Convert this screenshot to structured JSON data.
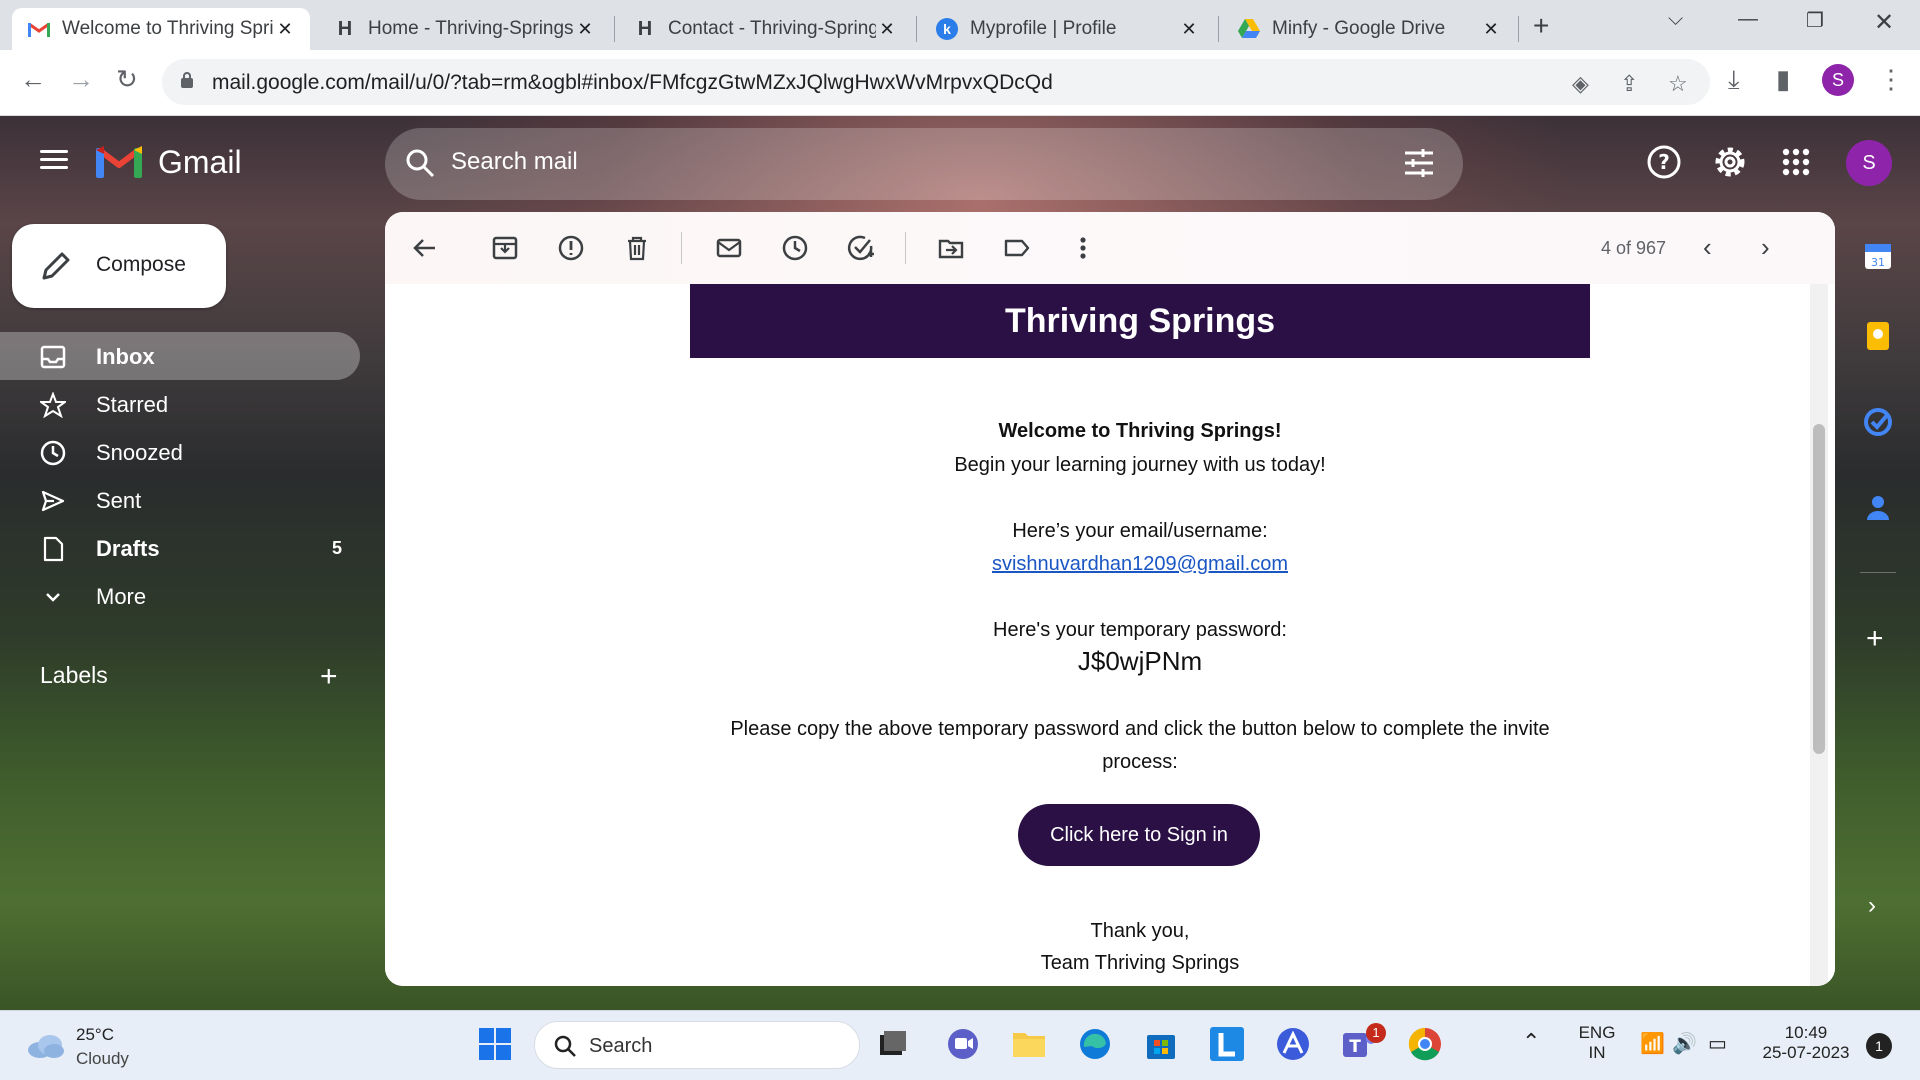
{
  "browser": {
    "tabs": [
      {
        "label": "Welcome to Thriving Spri",
        "active": true,
        "icon": "gmail-icon"
      },
      {
        "label": "Home - Thriving-Springs",
        "active": false,
        "icon": "h-site-icon"
      },
      {
        "label": "Contact - Thriving-Spring",
        "active": false,
        "icon": "h-site-icon"
      },
      {
        "label": "Myprofile | Profile",
        "active": false,
        "icon": "k-site-icon"
      },
      {
        "label": "Minfy - Google Drive",
        "active": false,
        "icon": "google-drive-icon"
      }
    ],
    "url": "mail.google.com/mail/u/0/?tab=rm&ogbl#inbox/FMfcgzGtwMZxJQlwgHwxWvMrpvxQDcQd",
    "profile_initial": "S"
  },
  "gmail": {
    "app_name": "Gmail",
    "search_placeholder": "Search mail",
    "avatar_initial": "S",
    "compose_label": "Compose",
    "nav": [
      {
        "label": "Inbox",
        "icon": "inbox-icon",
        "selected": true,
        "bold": true,
        "count": ""
      },
      {
        "label": "Starred",
        "icon": "star-icon",
        "selected": false,
        "bold": false,
        "count": ""
      },
      {
        "label": "Snoozed",
        "icon": "clock-icon",
        "selected": false,
        "bold": false,
        "count": ""
      },
      {
        "label": "Sent",
        "icon": "send-icon",
        "selected": false,
        "bold": false,
        "count": ""
      },
      {
        "label": "Drafts",
        "icon": "draft-icon",
        "selected": false,
        "bold": true,
        "count": "5"
      },
      {
        "label": "More",
        "icon": "chevron-down-icon",
        "selected": false,
        "bold": false,
        "count": ""
      }
    ],
    "labels_heading": "Labels",
    "pager": "4 of 967"
  },
  "email": {
    "banner_title": "Thriving Springs",
    "welcome_heading": "Welcome to Thriving Springs!",
    "welcome_sub": "Begin your learning journey with us today!",
    "username_label": "Here’s your email/username:",
    "username_value": "svishnuvardhan1209@gmail.com",
    "password_label": "Here's your temporary password:",
    "password_value": "J$0wjPNm",
    "instructions_line1": "Please copy the above temporary password and click the button below to complete the invite",
    "instructions_line2": "process:",
    "signin_button": "Click here to Sign in",
    "thanks": "Thank you,",
    "signature": "Team Thriving Springs"
  },
  "taskbar": {
    "temperature": "25°C",
    "condition": "Cloudy",
    "search_label": "Search",
    "lang_line1": "ENG",
    "lang_line2": "IN",
    "time": "10:49",
    "date": "25-07-2023",
    "notification_count": "1",
    "teams_badge": "1"
  },
  "colors": {
    "brand_purple": "#2a1045",
    "link_blue": "#1a56c4",
    "avatar_purple": "#8e24aa"
  }
}
